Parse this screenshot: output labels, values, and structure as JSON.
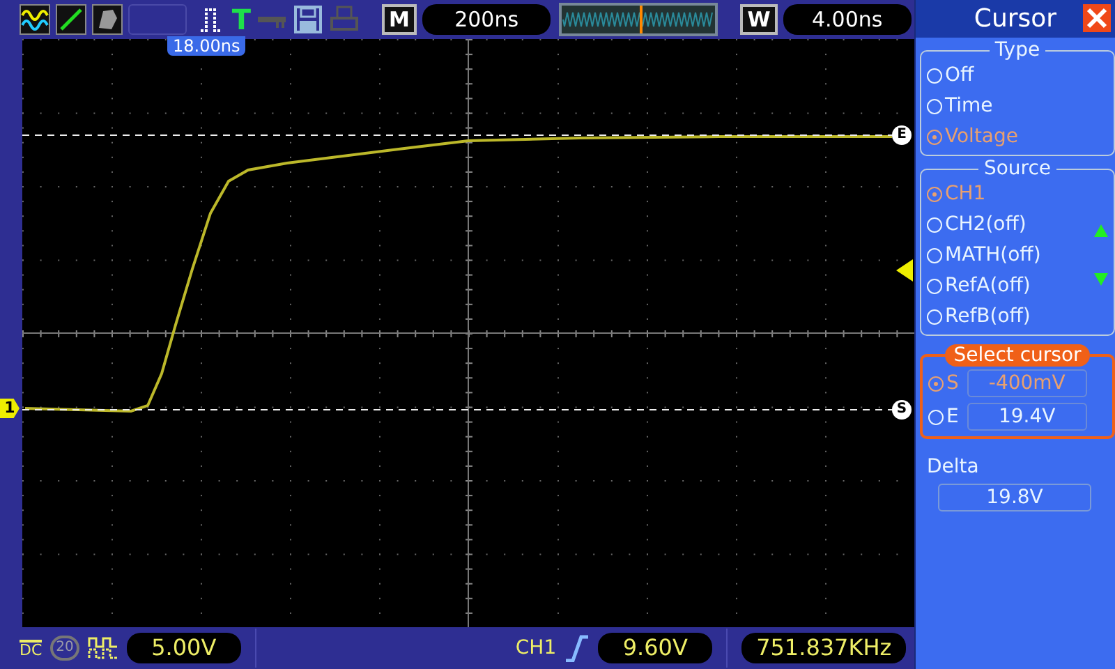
{
  "toolbar": {
    "trigger_label": "T",
    "main_label": "M",
    "timebase": "200ns",
    "window_label": "W",
    "window_timebase": "4.00ns"
  },
  "screen": {
    "trigger_position": "18.00ns",
    "channel_marker": "1",
    "cursor_start_marker": "S",
    "cursor_end_marker": "E"
  },
  "panel": {
    "title": "Cursor",
    "type": {
      "legend": "Type",
      "options": [
        {
          "label": "Off",
          "selected": false
        },
        {
          "label": "Time",
          "selected": false
        },
        {
          "label": "Voltage",
          "selected": true
        }
      ]
    },
    "source": {
      "legend": "Source",
      "options": [
        {
          "label": "CH1",
          "selected": true
        },
        {
          "label": "CH2(off)",
          "selected": false
        },
        {
          "label": "MATH(off)",
          "selected": false
        },
        {
          "label": "RefA(off)",
          "selected": false
        },
        {
          "label": "RefB(off)",
          "selected": false
        }
      ]
    },
    "select_cursor": {
      "legend": "Select cursor",
      "cursors": [
        {
          "label": "S",
          "value": "-400mV",
          "selected": true
        },
        {
          "label": "E",
          "value": "19.4V",
          "selected": false
        }
      ]
    },
    "delta": {
      "label": "Delta",
      "value": "19.8V"
    }
  },
  "status_bar": {
    "coupling": "DC",
    "bandwidth_limit": {
      "label": "20",
      "on": false
    },
    "volts_per_div": "5.00V",
    "trigger_source": "CH1",
    "trigger_level": "9.60V",
    "frequency": "751.837KHz"
  }
}
